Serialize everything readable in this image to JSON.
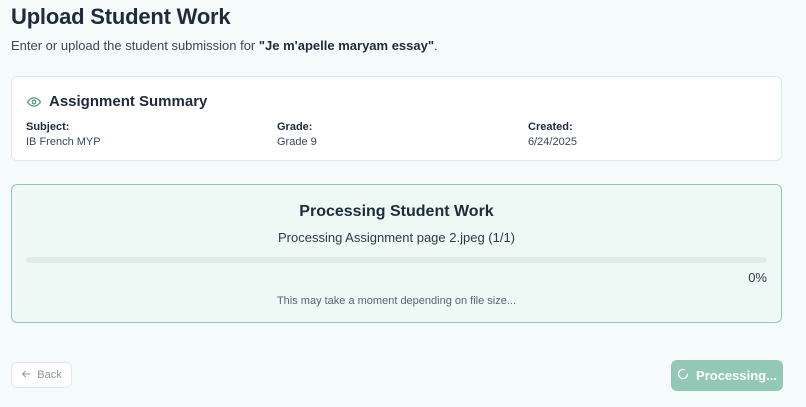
{
  "header": {
    "title": "Upload Student Work",
    "subtitle_prefix": "Enter or upload the student submission for ",
    "assignment_name": "\"Je m'apelle maryam essay\"",
    "subtitle_suffix": "."
  },
  "summary": {
    "title": "Assignment Summary",
    "icon": "eye-icon",
    "fields": [
      {
        "label": "Subject:",
        "value": "IB French MYP"
      },
      {
        "label": "Grade:",
        "value": "Grade 9"
      },
      {
        "label": "Created:",
        "value": "6/24/2025"
      }
    ]
  },
  "processing": {
    "title": "Processing Student Work",
    "status": "Processing Assignment page 2.jpeg (1/1)",
    "progress_percent": 0,
    "progress_label": "0%",
    "hint": "This may take a moment depending on file size..."
  },
  "footer": {
    "back_label": "Back",
    "processing_label": "Processing..."
  },
  "colors": {
    "accent": "#6fae9c",
    "button_disabled": "#93c7b6",
    "card_border": "#94c7b8",
    "card_bg": "#eef8f5"
  }
}
